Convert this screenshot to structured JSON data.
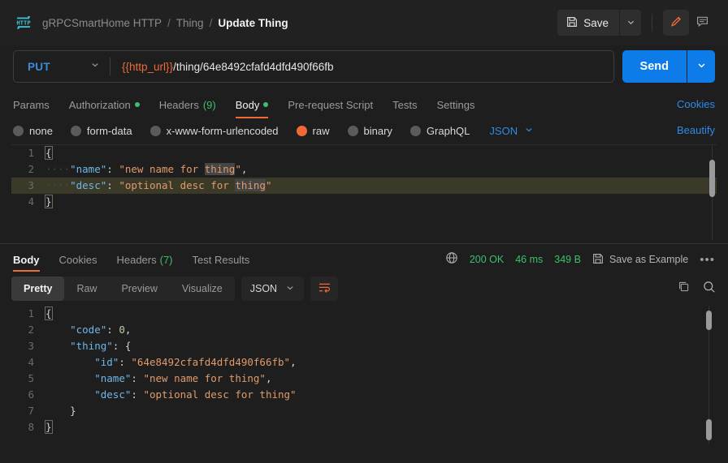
{
  "header": {
    "logo_icon": "http-logo-icon",
    "breadcrumb": [
      "gRPCSmartHome HTTP",
      "Thing",
      "Update Thing"
    ],
    "separator": "/",
    "save_label": "Save",
    "save_icon": "floppy-disk-icon",
    "save_caret_icon": "chevron-down-icon",
    "edit_icon": "pencil-icon",
    "comment_icon": "comment-icon"
  },
  "request": {
    "method": "PUT",
    "method_caret_icon": "chevron-down-icon",
    "url_variable": "{{http_url}}",
    "url_path": "/thing/64e8492cfafd4dfd490f66fb",
    "send_label": "Send",
    "send_caret_icon": "chevron-down-icon",
    "tabs": [
      {
        "label": "Params",
        "active": false,
        "dot": false,
        "count": ""
      },
      {
        "label": "Authorization",
        "active": false,
        "dot": true,
        "count": ""
      },
      {
        "label": "Headers",
        "active": false,
        "dot": false,
        "count": "(9)"
      },
      {
        "label": "Body",
        "active": true,
        "dot": true,
        "count": ""
      },
      {
        "label": "Pre-request Script",
        "active": false,
        "dot": false,
        "count": ""
      },
      {
        "label": "Tests",
        "active": false,
        "dot": false,
        "count": ""
      },
      {
        "label": "Settings",
        "active": false,
        "dot": false,
        "count": ""
      }
    ],
    "cookies_link": "Cookies",
    "body_types": [
      {
        "label": "none",
        "selected": false
      },
      {
        "label": "form-data",
        "selected": false
      },
      {
        "label": "x-www-form-urlencoded",
        "selected": false
      },
      {
        "label": "raw",
        "selected": true
      },
      {
        "label": "binary",
        "selected": false
      },
      {
        "label": "GraphQL",
        "selected": false
      }
    ],
    "raw_format": "JSON",
    "raw_format_caret_icon": "chevron-down-icon",
    "beautify_link": "Beautify",
    "body_lines": [
      {
        "n": "1",
        "text": "{"
      },
      {
        "n": "2",
        "text": "    \"name\": \"new name for thing\","
      },
      {
        "n": "3",
        "text": "    \"desc\": \"optional desc for thing\""
      },
      {
        "n": "4",
        "text": "}"
      }
    ],
    "highlighted_line": "3"
  },
  "response": {
    "tabs": [
      {
        "label": "Body",
        "active": true,
        "count": ""
      },
      {
        "label": "Cookies",
        "active": false,
        "count": ""
      },
      {
        "label": "Headers",
        "active": false,
        "count": "(7)"
      },
      {
        "label": "Test Results",
        "active": false,
        "count": ""
      }
    ],
    "globe_icon": "globe-icon",
    "status": "200 OK",
    "time": "46 ms",
    "size": "349 B",
    "save_example_icon": "floppy-disk-icon",
    "save_example_label": "Save as Example",
    "more_icon": "ellipsis-icon",
    "view_modes": [
      {
        "label": "Pretty",
        "active": true
      },
      {
        "label": "Raw",
        "active": false
      },
      {
        "label": "Preview",
        "active": false
      },
      {
        "label": "Visualize",
        "active": false
      }
    ],
    "format": "JSON",
    "format_caret_icon": "chevron-down-icon",
    "wrap_icon": "word-wrap-icon",
    "copy_icon": "copy-icon",
    "search_icon": "search-icon",
    "body_lines": [
      {
        "n": "1",
        "text": "{"
      },
      {
        "n": "2",
        "text": "    \"code\": 0,"
      },
      {
        "n": "3",
        "text": "    \"thing\": {"
      },
      {
        "n": "4",
        "text": "        \"id\": \"64e8492cfafd4dfd490f66fb\","
      },
      {
        "n": "5",
        "text": "        \"name\": \"new name for thing\","
      },
      {
        "n": "6",
        "text": "        \"desc\": \"optional desc for thing\""
      },
      {
        "n": "7",
        "text": "    }"
      },
      {
        "n": "8",
        "text": "}"
      }
    ]
  },
  "colors": {
    "accent_orange": "#ef6a36",
    "accent_blue": "#0d7ce8",
    "link_blue": "#2f8ae8",
    "success_green": "#3dbf6b",
    "method_blue": "#3a8dde",
    "background": "#1e1e1e",
    "panel": "#212121"
  }
}
